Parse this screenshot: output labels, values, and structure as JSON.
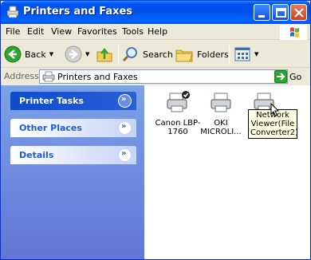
{
  "window": {
    "title": "Printers and Faxes",
    "icon": "printers-faxes-icon"
  },
  "menu": [
    "File",
    "Edit",
    "View",
    "Favorites",
    "Tools",
    "Help"
  ],
  "toolbar": {
    "back_label": "Back",
    "search_label": "Search",
    "folders_label": "Folders"
  },
  "address": {
    "label": "Address",
    "value": "Printers and Faxes",
    "go_label": "Go"
  },
  "taskpane": {
    "groups": [
      {
        "label": "Printer Tasks",
        "special": true
      },
      {
        "label": "Other Places",
        "special": false
      },
      {
        "label": "Details",
        "special": false
      }
    ]
  },
  "printers": [
    {
      "name": "Canon LBP-1760",
      "default": true
    },
    {
      "name": "OKI MICROLI...",
      "default": false
    },
    {
      "name": "Network Viewer(File Converter2)",
      "default": false
    }
  ],
  "tooltip": "Network Viewer(File Converter2)",
  "colors": {
    "title_bar": "#0053ee",
    "task_pane": "#7ba2e7",
    "header_special": "#0e4ccd"
  }
}
